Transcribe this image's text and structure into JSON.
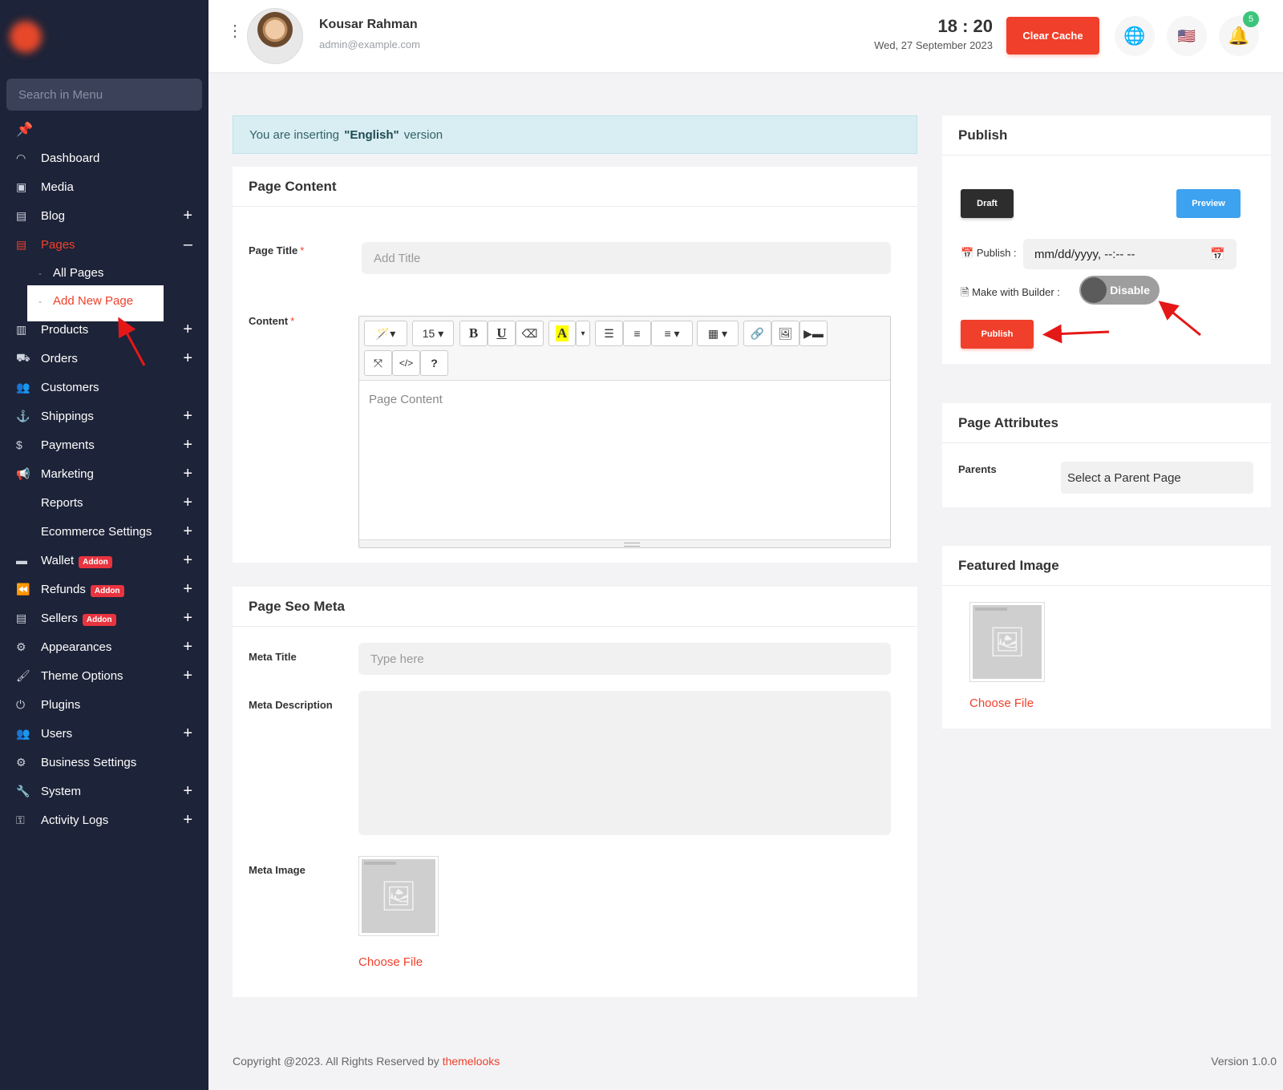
{
  "sidebar": {
    "search_placeholder": "Search in Menu",
    "menu": [
      {
        "label": "Dashboard",
        "icon": "dashboard-icon",
        "expandable": false
      },
      {
        "label": "Media",
        "icon": "media-icon",
        "expandable": false
      },
      {
        "label": "Blog",
        "icon": "blog-icon",
        "expandable": true
      },
      {
        "label": "Pages",
        "icon": "pages-icon",
        "expandable": true,
        "active": true
      },
      {
        "label": "Products",
        "icon": "products-icon",
        "expandable": true
      },
      {
        "label": "Orders",
        "icon": "orders-icon",
        "expandable": true
      },
      {
        "label": "Customers",
        "icon": "customers-icon",
        "expandable": false
      },
      {
        "label": "Shippings",
        "icon": "shippings-icon",
        "expandable": true
      },
      {
        "label": "Payments",
        "icon": "payments-icon",
        "expandable": true
      },
      {
        "label": "Marketing",
        "icon": "marketing-icon",
        "expandable": true
      },
      {
        "label": "Reports",
        "expandable": true
      },
      {
        "label": "Ecommerce Settings",
        "expandable": true
      },
      {
        "label": "Wallet",
        "icon": "wallet-icon",
        "expandable": true,
        "badge": "Addon"
      },
      {
        "label": "Refunds",
        "icon": "refunds-icon",
        "expandable": true,
        "badge": "Addon"
      },
      {
        "label": "Sellers",
        "icon": "sellers-icon",
        "expandable": true,
        "badge": "Addon"
      },
      {
        "label": "Appearances",
        "icon": "appearances-icon",
        "expandable": true
      },
      {
        "label": "Theme Options",
        "icon": "theme-options-icon",
        "expandable": true
      },
      {
        "label": "Plugins",
        "icon": "plugins-icon",
        "expandable": false
      },
      {
        "label": "Users",
        "icon": "users-icon",
        "expandable": true
      },
      {
        "label": "Business Settings",
        "icon": "business-settings-icon",
        "expandable": false
      },
      {
        "label": "System",
        "icon": "system-icon",
        "expandable": true
      },
      {
        "label": "Activity Logs",
        "icon": "activity-logs-icon",
        "expandable": true
      }
    ],
    "pages_sub": [
      "All Pages",
      "Add New Page"
    ],
    "expand_glyph": "+",
    "collapse_glyph": "–"
  },
  "header": {
    "user_name": "Kousar Rahman",
    "user_email": "admin@example.com",
    "time": "18 : 20",
    "date": "Wed, 27 September 2023",
    "clear_cache_label": "Clear Cache",
    "notification_count": "5"
  },
  "alert": {
    "prefix": "You are inserting",
    "language": "\"English\"",
    "suffix": "version"
  },
  "page_content": {
    "title": "Page Content",
    "page_title_label": "Page Title",
    "page_title_placeholder": "Add Title",
    "content_label": "Content",
    "content_placeholder": "Page Content",
    "font_size": "15",
    "required_mark": "*"
  },
  "seo": {
    "title": "Page Seo Meta",
    "meta_title_label": "Meta Title",
    "meta_title_placeholder": "Type here",
    "meta_description_label": "Meta Description",
    "meta_image_label": "Meta Image",
    "choose_file": "Choose File"
  },
  "publish": {
    "title": "Publish",
    "draft_label": "Draft",
    "preview_label": "Preview",
    "publish_date_label": "Publish :",
    "publish_date_value": "mm/dd/yyyy, --:-- --",
    "builder_label": "Make with Builder :",
    "builder_toggle": "Disable",
    "publish_button": "Publish"
  },
  "attributes": {
    "title": "Page Attributes",
    "parents_label": "Parents",
    "parents_value": "Select a Parent Page"
  },
  "featured": {
    "title": "Featured Image",
    "choose_file": "Choose File"
  },
  "footer": {
    "copyright": "Copyright @2023. All Rights Reserved by",
    "brand": "themelooks",
    "version": "Version 1.0.0"
  },
  "colors": {
    "accent": "#f0402b",
    "sidebar_bg": "#1d2338",
    "preview": "#3da2f0"
  }
}
